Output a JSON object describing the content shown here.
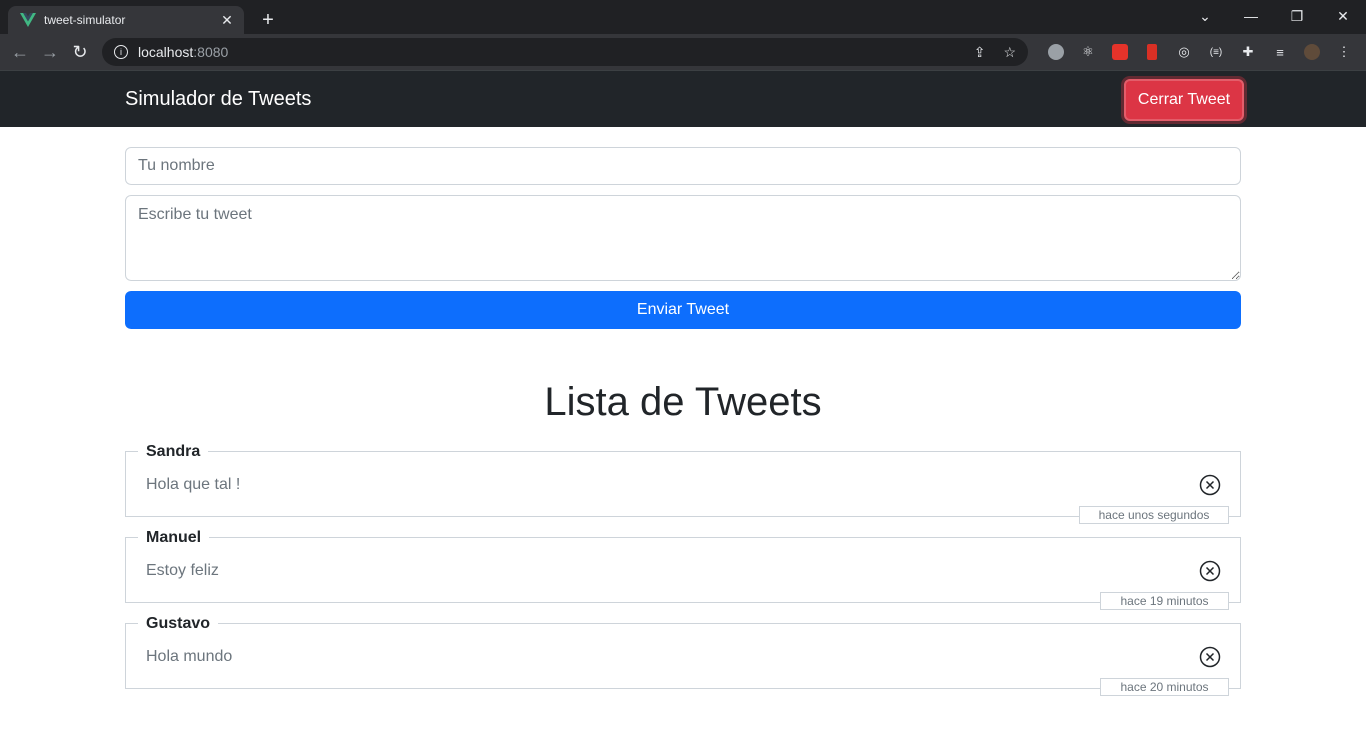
{
  "browser": {
    "tab_title": "tweet-simulator",
    "url_host": "localhost",
    "url_port": ":8080"
  },
  "navbar": {
    "brand": "Simulador de Tweets",
    "close_button": "Cerrar Tweet"
  },
  "form": {
    "name_placeholder": "Tu nombre",
    "tweet_placeholder": "Escribe tu tweet",
    "submit_label": "Enviar Tweet"
  },
  "list": {
    "title": "Lista de Tweets",
    "tweets": [
      {
        "author": "Sandra",
        "text": "Hola que tal !",
        "time": "hace unos segundos"
      },
      {
        "author": "Manuel",
        "text": "Estoy feliz",
        "time": "hace 19 minutos"
      },
      {
        "author": "Gustavo",
        "text": "Hola mundo",
        "time": "hace 20 minutos"
      }
    ]
  },
  "colors": {
    "navbar_bg": "#212529",
    "danger": "#dc3545",
    "primary": "#0d6efd",
    "vue_green": "#41b883"
  }
}
